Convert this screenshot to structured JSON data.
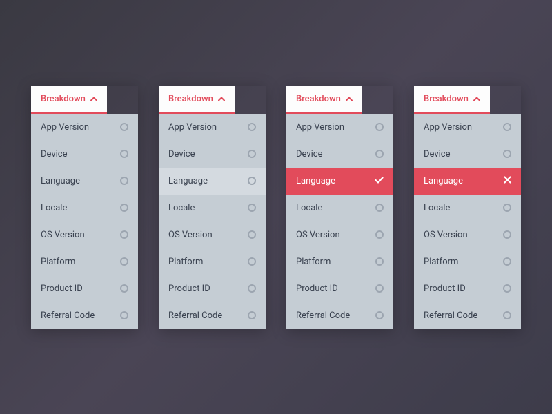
{
  "dropdowns": [
    {
      "title": "Breakdown",
      "items": [
        {
          "label": "App Version",
          "state": "default"
        },
        {
          "label": "Device",
          "state": "default"
        },
        {
          "label": "Language",
          "state": "default"
        },
        {
          "label": "Locale",
          "state": "default"
        },
        {
          "label": "OS Version",
          "state": "default"
        },
        {
          "label": "Platform",
          "state": "default"
        },
        {
          "label": "Product ID",
          "state": "default"
        },
        {
          "label": "Referral Code",
          "state": "default"
        }
      ]
    },
    {
      "title": "Breakdown",
      "items": [
        {
          "label": "App Version",
          "state": "default"
        },
        {
          "label": "Device",
          "state": "default"
        },
        {
          "label": "Language",
          "state": "hover"
        },
        {
          "label": "Locale",
          "state": "default"
        },
        {
          "label": "OS Version",
          "state": "default"
        },
        {
          "label": "Platform",
          "state": "default"
        },
        {
          "label": "Product ID",
          "state": "default"
        },
        {
          "label": "Referral Code",
          "state": "default"
        }
      ]
    },
    {
      "title": "Breakdown",
      "items": [
        {
          "label": "App Version",
          "state": "default"
        },
        {
          "label": "Device",
          "state": "default"
        },
        {
          "label": "Language",
          "state": "selected-check"
        },
        {
          "label": "Locale",
          "state": "default"
        },
        {
          "label": "OS Version",
          "state": "default"
        },
        {
          "label": "Platform",
          "state": "default"
        },
        {
          "label": "Product ID",
          "state": "default"
        },
        {
          "label": "Referral Code",
          "state": "default"
        }
      ]
    },
    {
      "title": "Breakdown",
      "items": [
        {
          "label": "App Version",
          "state": "default"
        },
        {
          "label": "Device",
          "state": "default"
        },
        {
          "label": "Language",
          "state": "selected-close"
        },
        {
          "label": "Locale",
          "state": "default"
        },
        {
          "label": "OS Version",
          "state": "default"
        },
        {
          "label": "Platform",
          "state": "default"
        },
        {
          "label": "Product ID",
          "state": "default"
        },
        {
          "label": "Referral Code",
          "state": "default"
        }
      ]
    }
  ],
  "colors": {
    "accent": "#e24b5b",
    "listBg": "#c5cdd4",
    "hoverBg": "#d4dae0",
    "text": "#3a4250"
  }
}
